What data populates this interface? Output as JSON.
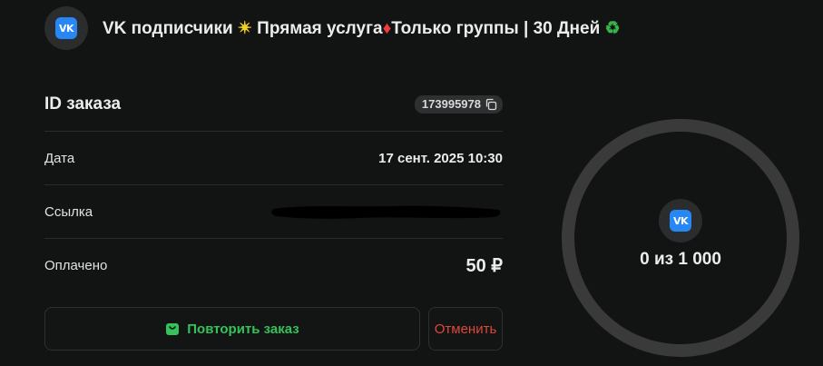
{
  "header": {
    "icon": "vk-logo-icon",
    "title_part1": "VK подписчики ",
    "title_star": "✴",
    "title_part2": " Прямая услуга",
    "title_diamond": "♦",
    "title_part3": "Только группы | 30 Дней ",
    "title_recycle": "♻"
  },
  "order": {
    "id_label": "ID заказа",
    "id_value": "173995978",
    "copy_icon": "copy-icon",
    "date_label": "Дата",
    "date_value": "17 сент. 2025 10:30",
    "link_label": "Ссылка",
    "link_value_redacted": true,
    "paid_label": "Оплачено",
    "paid_value": "50 ₽"
  },
  "actions": {
    "repeat_label": "Повторить заказ",
    "repeat_icon": "shopping-bag-icon",
    "cancel_label": "Отменить"
  },
  "progress": {
    "text": "0 из 1 000",
    "done": 0,
    "total": 1000,
    "icon": "vk-logo-icon"
  },
  "colors": {
    "background": "#121313",
    "vk_blue": "#2787f5",
    "repeat_green": "#35c25a",
    "cancel_red": "#e0473a",
    "ring_track": "#3a3a3a"
  }
}
